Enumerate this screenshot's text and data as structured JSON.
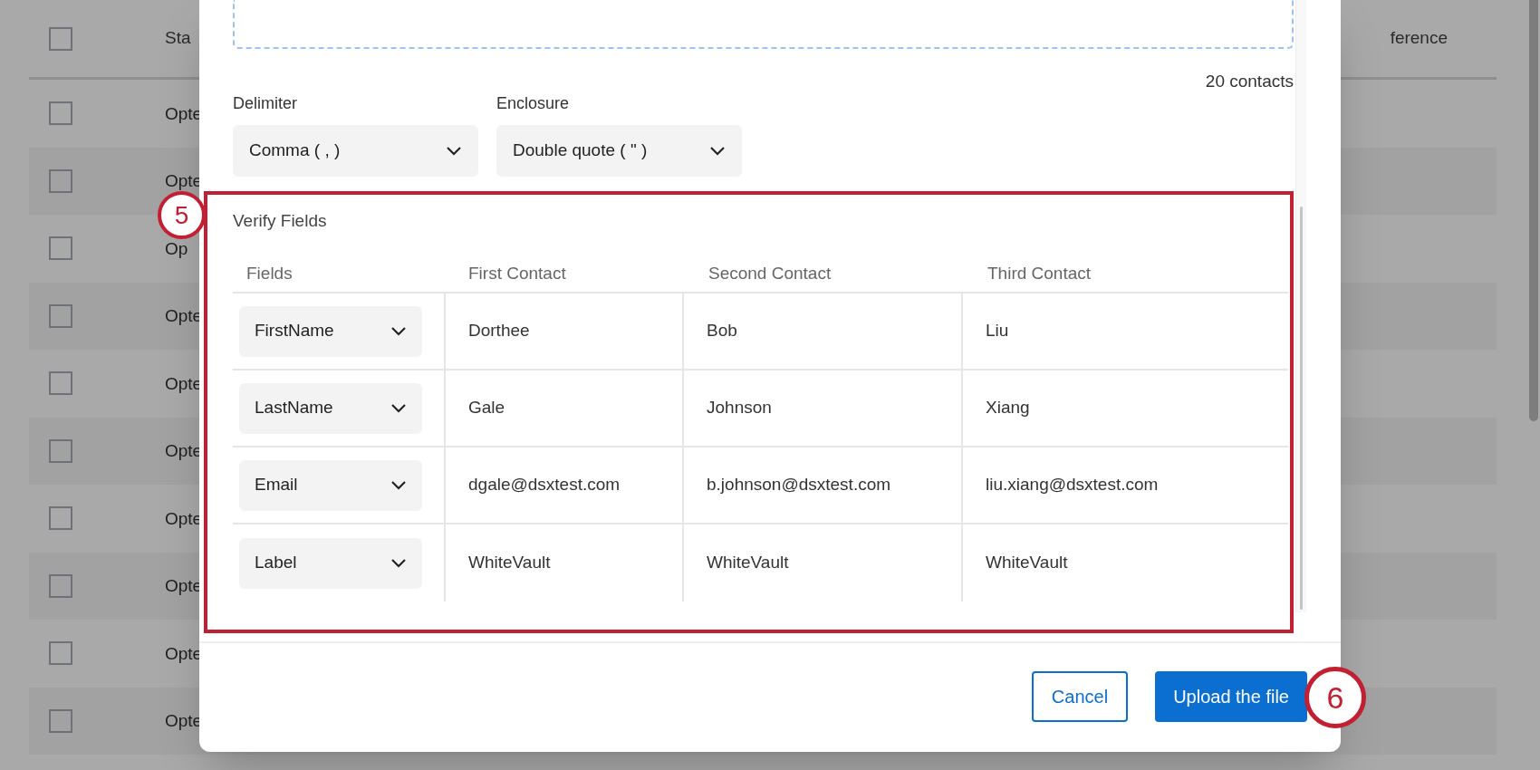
{
  "background_table": {
    "header_checkbox": {
      "checked": false
    },
    "columns": [
      "Sta",
      "ference"
    ],
    "rows": [
      {
        "status": "Opte",
        "checked": false
      },
      {
        "status": "Opte",
        "checked": false
      },
      {
        "status": "Op",
        "checked": false
      },
      {
        "status": "Opte",
        "checked": false
      },
      {
        "status": "Opte",
        "checked": false
      },
      {
        "status": "Opte",
        "checked": false
      },
      {
        "status": "Opte",
        "checked": false
      },
      {
        "status": "Opte",
        "checked": false
      },
      {
        "status": "Opte",
        "checked": false
      },
      {
        "status": "Opte",
        "checked": false
      }
    ]
  },
  "dialog": {
    "contact_count": "20 contacts",
    "delimiter": {
      "label": "Delimiter",
      "value": "Comma ( , )"
    },
    "enclosure": {
      "label": "Enclosure",
      "value": "Double quote ( \" )"
    },
    "verify": {
      "title": "Verify Fields",
      "columns": [
        "Fields",
        "First Contact",
        "Second Contact",
        "Third Contact"
      ],
      "rows": [
        {
          "field": "FirstName",
          "values": [
            "Dorthee",
            "Bob",
            "Liu"
          ]
        },
        {
          "field": "LastName",
          "values": [
            "Gale",
            "Johnson",
            "Xiang"
          ]
        },
        {
          "field": "Email",
          "values": [
            "dgale@dsxtest.com",
            "b.johnson@dsxtest.com",
            "liu.xiang@dsxtest.com"
          ]
        },
        {
          "field": "Label",
          "values": [
            "WhiteVault",
            "WhiteVault",
            "WhiteVault"
          ]
        }
      ]
    },
    "buttons": [
      {
        "label": "Cancel",
        "kind": "secondary"
      },
      {
        "label": "Upload the file",
        "kind": "primary"
      }
    ]
  },
  "annotations": [
    {
      "label": "5"
    },
    {
      "label": "6"
    }
  ]
}
